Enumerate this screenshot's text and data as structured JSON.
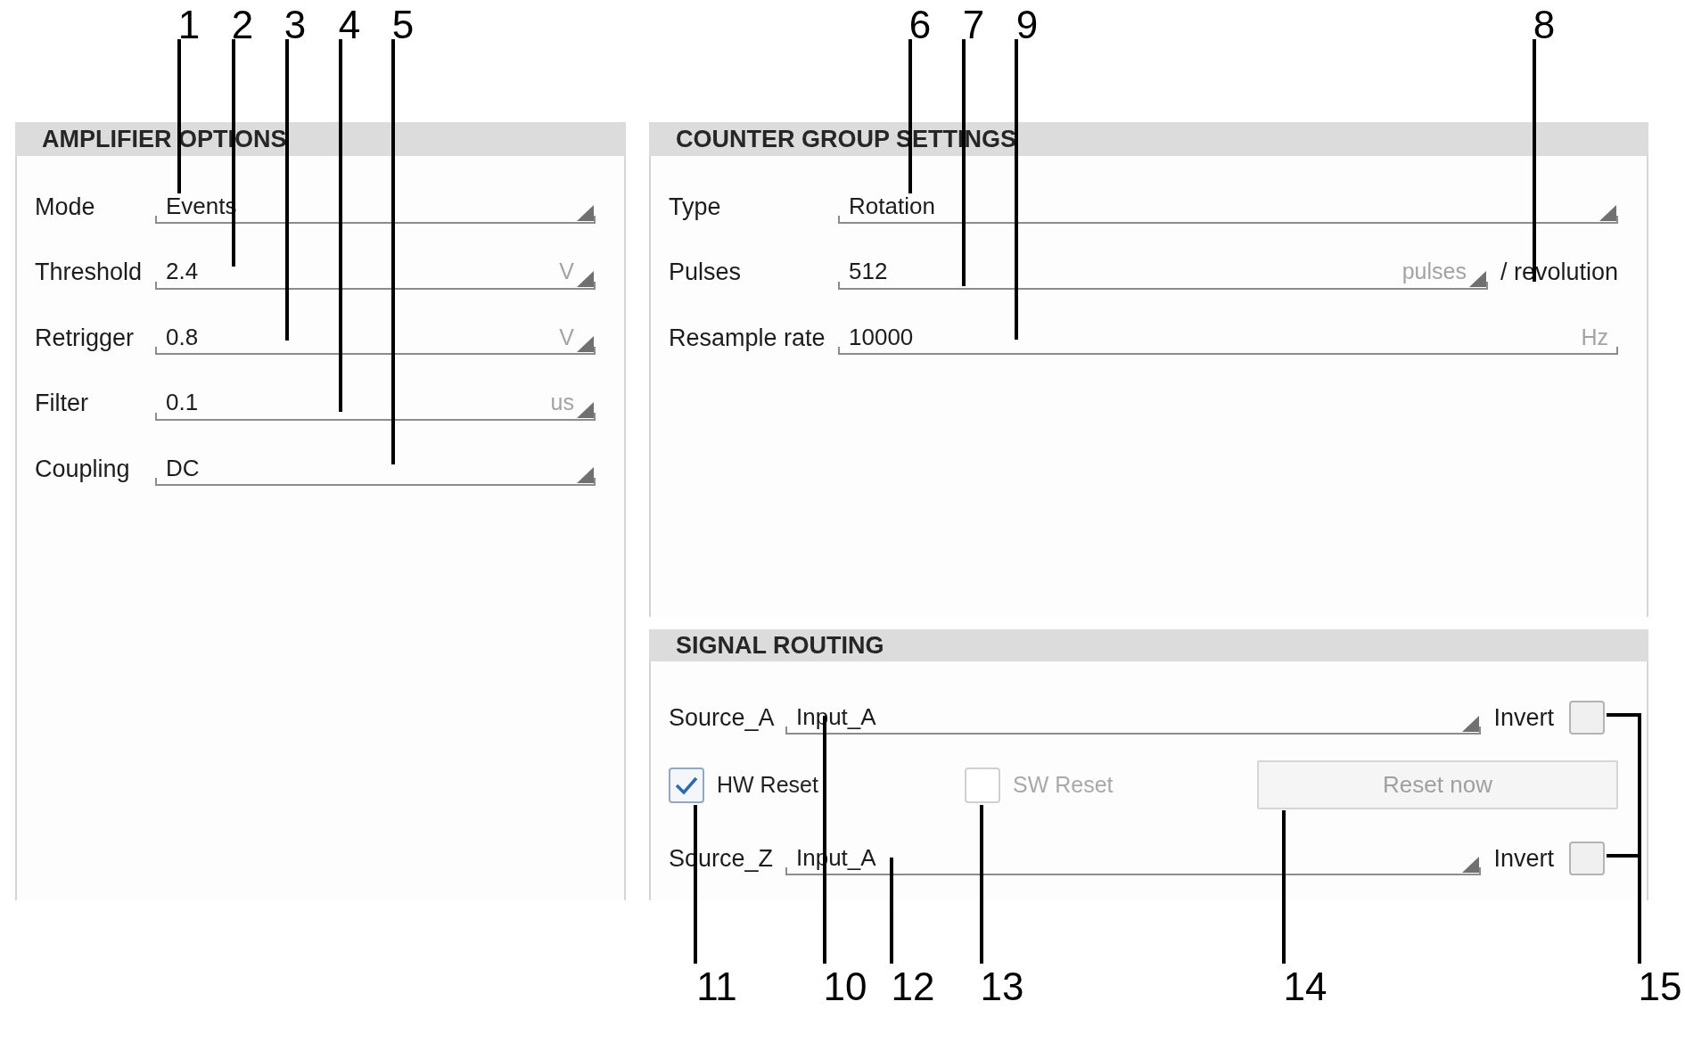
{
  "callouts": [
    {
      "number": "1"
    },
    {
      "number": "2"
    },
    {
      "number": "3"
    },
    {
      "number": "4"
    },
    {
      "number": "5"
    },
    {
      "number": "6"
    },
    {
      "number": "7"
    },
    {
      "number": "9"
    },
    {
      "number": "8"
    },
    {
      "number": "11"
    },
    {
      "number": "10"
    },
    {
      "number": "12"
    },
    {
      "number": "13"
    },
    {
      "number": "14"
    },
    {
      "number": "15"
    }
  ],
  "amplifier_options": {
    "title": "AMPLIFIER OPTIONS",
    "fields": [
      {
        "label": "Mode",
        "value": "Events",
        "kind": "dropdown"
      },
      {
        "label": "Threshold",
        "value": "2.4",
        "unit": "V",
        "kind": "dropdown"
      },
      {
        "label": "Retrigger",
        "value": "0.8",
        "unit": "V",
        "kind": "dropdown"
      },
      {
        "label": "Filter",
        "value": "0.1",
        "unit": "us",
        "kind": "dropdown"
      },
      {
        "label": "Coupling",
        "value": "DC",
        "kind": "dropdown"
      }
    ]
  },
  "counter_group_settings": {
    "title": "COUNTER GROUP SETTINGS",
    "fields": [
      {
        "label": "Type",
        "value": "Rotation",
        "kind": "dropdown"
      },
      {
        "label": "Pulses",
        "value": "512",
        "unit": "pulses",
        "kind": "dropdown",
        "suffix": "/ revolution"
      },
      {
        "label": "Resample rate",
        "value": "10000",
        "unit": "Hz",
        "kind": "input"
      }
    ]
  },
  "signal_routing": {
    "title": "SIGNAL ROUTING",
    "rows": [
      {
        "kind": "source",
        "label": "Source_A",
        "field": {
          "value": "Input_A",
          "kind": "dropdown"
        },
        "invert": {
          "label": "Invert",
          "checked": false
        }
      },
      {
        "kind": "reset",
        "checkboxes": [
          {
            "label": "HW Reset",
            "checked": true,
            "disabled": false
          },
          {
            "label": "SW Reset",
            "checked": false,
            "disabled": true
          }
        ],
        "button": {
          "label": "Reset now",
          "disabled": true
        }
      },
      {
        "kind": "source",
        "label": "Source_Z",
        "field": {
          "value": "Input_A",
          "kind": "dropdown"
        },
        "invert": {
          "label": "Invert",
          "checked": false
        }
      }
    ]
  }
}
